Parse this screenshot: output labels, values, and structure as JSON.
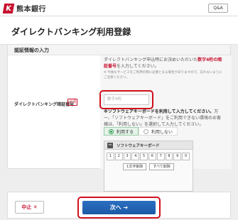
{
  "header": {
    "logo_mark": "K",
    "logo_text": "熊本銀行",
    "qa_label": "Q&A"
  },
  "page_title": "ダイレクトバンキング利用登録",
  "section": {
    "title": "認証情報の入力"
  },
  "field": {
    "label": "ダイレクトバンキング暗証番号",
    "required": "必須",
    "desc_1": "ダイレクトバンキング申込時にお決めいただいた",
    "desc_red": "数字4桁の暗証番号",
    "desc_2": "を入力してください。",
    "note": "※ 今後もサービスをご利用の際に必要となる場合がありますので、忘れないようにご注意ください。",
    "placeholder": "数字4桁"
  },
  "software_keyboard": {
    "text_bold": "※ソフトウェアキーボードを利用して入力してください。",
    "text_rest": "万一、「ソフトウェアキーボード」をご利用できない環境のお客様は、「利用しない」を選択して入力してください。",
    "use_label": "利用する",
    "nouse_label": "利用しない",
    "title": "ソフトウェアキーボード",
    "keys": [
      "1",
      "2",
      "3",
      "4",
      "5",
      "6",
      "7",
      "8",
      "9",
      "0"
    ],
    "delete_one": "1文字削除",
    "delete_all": "すべて削除"
  },
  "footer": {
    "cancel_label": "中止 ✕",
    "next_label": "次へ ➔"
  }
}
